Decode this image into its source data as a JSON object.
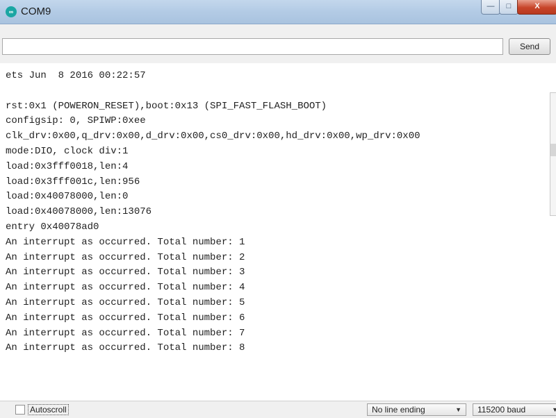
{
  "window": {
    "title": "COM9",
    "icon": "arduino-icon",
    "buttons": {
      "minimize": "—",
      "maximize": "□",
      "close": "X"
    }
  },
  "toolbar": {
    "input_value": "",
    "send_label": "Send"
  },
  "console": {
    "lines": [
      "ets Jun  8 2016 00:22:57",
      "",
      "rst:0x1 (POWERON_RESET),boot:0x13 (SPI_FAST_FLASH_BOOT)",
      "configsip: 0, SPIWP:0xee",
      "clk_drv:0x00,q_drv:0x00,d_drv:0x00,cs0_drv:0x00,hd_drv:0x00,wp_drv:0x00",
      "mode:DIO, clock div:1",
      "load:0x3fff0018,len:4",
      "load:0x3fff001c,len:956",
      "load:0x40078000,len:0",
      "load:0x40078000,len:13076",
      "entry 0x40078ad0",
      "An interrupt as occurred. Total number: 1",
      "An interrupt as occurred. Total number: 2",
      "An interrupt as occurred. Total number: 3",
      "An interrupt as occurred. Total number: 4",
      "An interrupt as occurred. Total number: 5",
      "An interrupt as occurred. Total number: 6",
      "An interrupt as occurred. Total number: 7",
      "An interrupt as occurred. Total number: 8"
    ]
  },
  "statusbar": {
    "autoscroll_label": "Autoscroll",
    "autoscroll_checked": false,
    "line_ending": "No line ending",
    "baud_rate": "115200 baud"
  },
  "colors": {
    "titlebar": "#b3cbe5",
    "close_button": "#c7452a",
    "app_icon": "#1ba6a3"
  }
}
